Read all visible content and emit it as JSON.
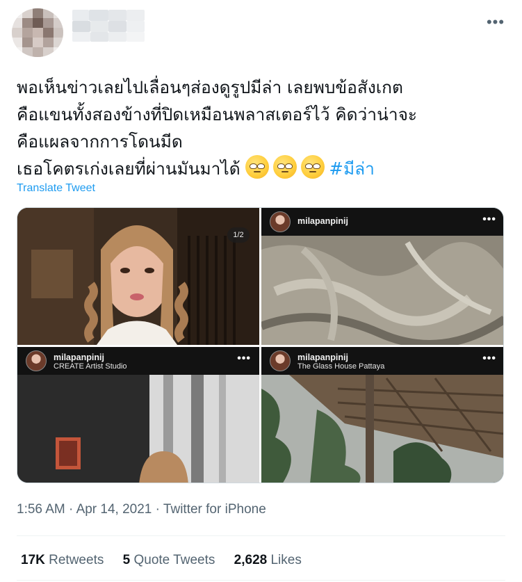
{
  "tweet": {
    "menu_icon": "more-horizontal-icon",
    "text_lines": [
      "พอเห็นข่าวเลยไปเลื่อนๆส่องดูรูปมีล่า เลยพบข้อสังเกต",
      "คือแขนทั้งสองข้างที่ปิดเหมือนพลาสเตอร์ไว้ คิดว่าน่าจะ",
      "คือแผลจากการโดนมีด",
      "เธอโคตรเก่งเลยที่ผ่านมันมาได้"
    ],
    "emojis": [
      "face-with-rolling-eyes",
      "face-with-rolling-eyes",
      "face-with-rolling-eyes"
    ],
    "hashtag": "#มีล่า",
    "translate": "Translate Tweet"
  },
  "media": {
    "counter": "1/2",
    "posts": [
      {
        "username": "milapanpinij",
        "location": ""
      },
      {
        "username": "milapanpinij",
        "location": "CREATE Artist Studio"
      },
      {
        "username": "milapanpinij",
        "location": "The Glass House Pattaya"
      }
    ],
    "dots": "•••"
  },
  "meta": {
    "time": "1:56 AM",
    "sep1": " · ",
    "date": "Apr 14, 2021",
    "sep2": " · ",
    "source": "Twitter for iPhone"
  },
  "stats": {
    "retweets_count": "17K",
    "retweets_label": "Retweets",
    "quotes_count": "5",
    "quotes_label": "Quote Tweets",
    "likes_count": "2,628",
    "likes_label": "Likes"
  }
}
